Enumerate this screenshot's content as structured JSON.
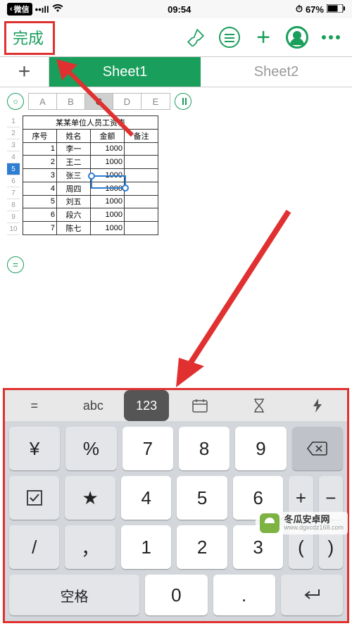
{
  "status": {
    "back_app": "微信",
    "signal": "••ıll",
    "wifi": "⌵",
    "time": "09:54",
    "alarm": "⏱",
    "battery_pct": "67%"
  },
  "toolbar": {
    "done": "完成"
  },
  "tabs": {
    "add": "+",
    "sheet1": "Sheet1",
    "sheet2": "Sheet2"
  },
  "columns": [
    "A",
    "B",
    "C",
    "D",
    "E"
  ],
  "col_selected": "C",
  "rows": [
    "1",
    "2",
    "3",
    "4",
    "5",
    "6",
    "7",
    "8",
    "9",
    "10"
  ],
  "row_selected": "5",
  "table": {
    "title": "某某单位人员工资表",
    "headers": [
      "序号",
      "姓名",
      "金额",
      "备注"
    ],
    "data": [
      {
        "no": "1",
        "name": "李一",
        "amt": "1000",
        "note": ""
      },
      {
        "no": "2",
        "name": "王二",
        "amt": "1000",
        "note": ""
      },
      {
        "no": "3",
        "name": "张三",
        "amt": "1000",
        "note": ""
      },
      {
        "no": "4",
        "name": "周四",
        "amt": "1000",
        "note": ""
      },
      {
        "no": "5",
        "name": "刘五",
        "amt": "1000",
        "note": ""
      },
      {
        "no": "6",
        "name": "段六",
        "amt": "1000",
        "note": ""
      },
      {
        "no": "7",
        "name": "陈七",
        "amt": "1000",
        "note": ""
      }
    ]
  },
  "equals": "=",
  "kb_toolbar": {
    "eq": "=",
    "abc": "abc",
    "num": "123",
    "date": "⊞",
    "hour": "⧖",
    "bolt": "⚡"
  },
  "keys": {
    "r1": [
      "¥",
      "%",
      "7",
      "8",
      "9",
      "⌫"
    ],
    "r2": [
      "☑",
      "★",
      "4",
      "5",
      "6",
      "+",
      "−"
    ],
    "r3": [
      "/",
      "，",
      "1",
      "2",
      "3",
      "(",
      ")"
    ],
    "r4_space": "空格",
    "r4_zero": "0",
    "r4_dot": ".",
    "r4_enter": "↵"
  },
  "watermark": {
    "line1": "冬瓜安卓网",
    "line2": "www.dgxcdz168.com"
  }
}
